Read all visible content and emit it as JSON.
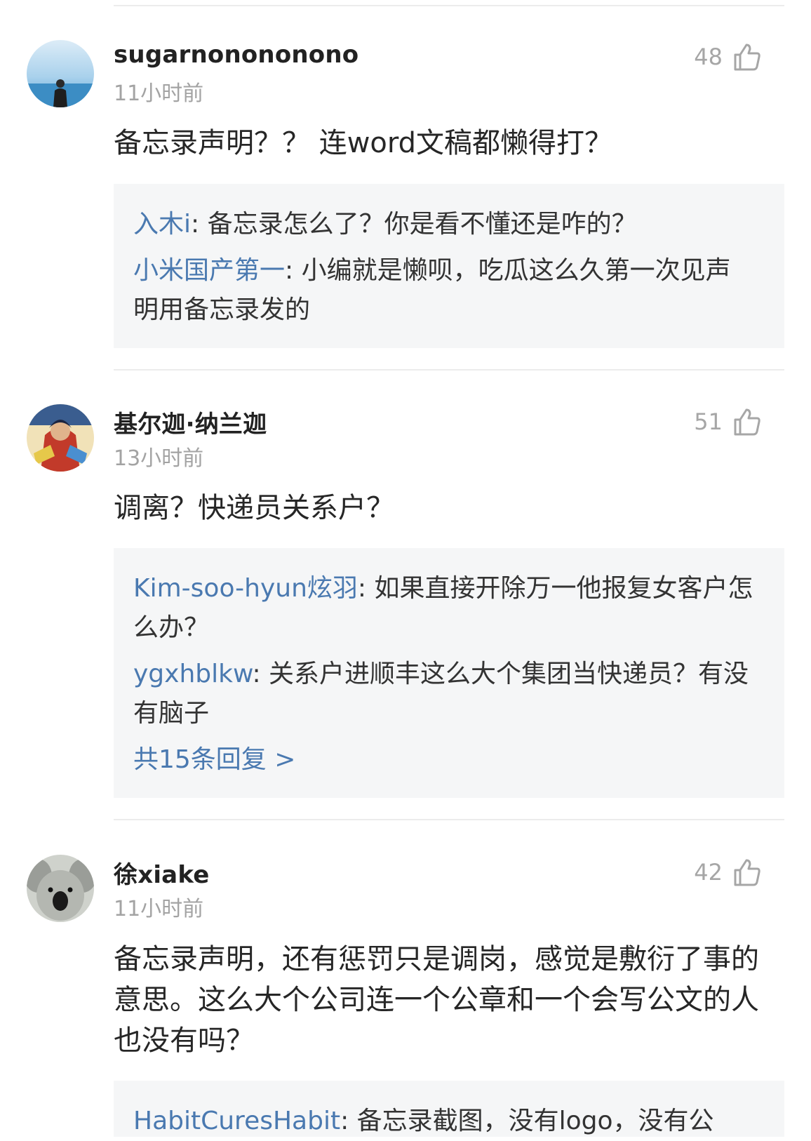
{
  "comments": [
    {
      "username": "sugarnonononono",
      "time": "11小时前",
      "likes": "48",
      "text": "备忘录声明？？ 连word文稿都懒得打？",
      "replies": [
        {
          "name": "入木i",
          "text": ": 备忘录怎么了？你是看不懂还是咋的？"
        },
        {
          "name": "小米国产第一",
          "text": ": 小编就是懒呗，吃瓜这么久第一次见声明用备忘录发的"
        }
      ]
    },
    {
      "username": "基尔迦·纳兰迦",
      "time": "13小时前",
      "likes": "51",
      "text": "调离？快递员关系户？",
      "replies": [
        {
          "name": "Kim-soo-hyun炫羽",
          "text": ": 如果直接开除万一他报复女客户怎么办？"
        },
        {
          "name": "ygxhblkw",
          "text": ": 关系户进顺丰这么大个集团当快递员？有没有脑子"
        }
      ],
      "more_replies": "共15条回复 >"
    },
    {
      "username": "徐xiake",
      "time": "11小时前",
      "likes": "42",
      "text": "备忘录声明，还有惩罚只是调岗，感觉是敷衍了事的意思。这么大个公司连一个公章和一个会写公文的人也没有吗？",
      "replies": [
        {
          "name": "HabitCuresHabit",
          "text": ": 备忘录截图，没有logo，没有公"
        }
      ]
    }
  ],
  "icons": {
    "like": "thumbs-up-icon"
  },
  "colors": {
    "reply_name": "#4a79b0",
    "reply_bg": "#f5f6f7",
    "muted": "#a3a3a3"
  }
}
